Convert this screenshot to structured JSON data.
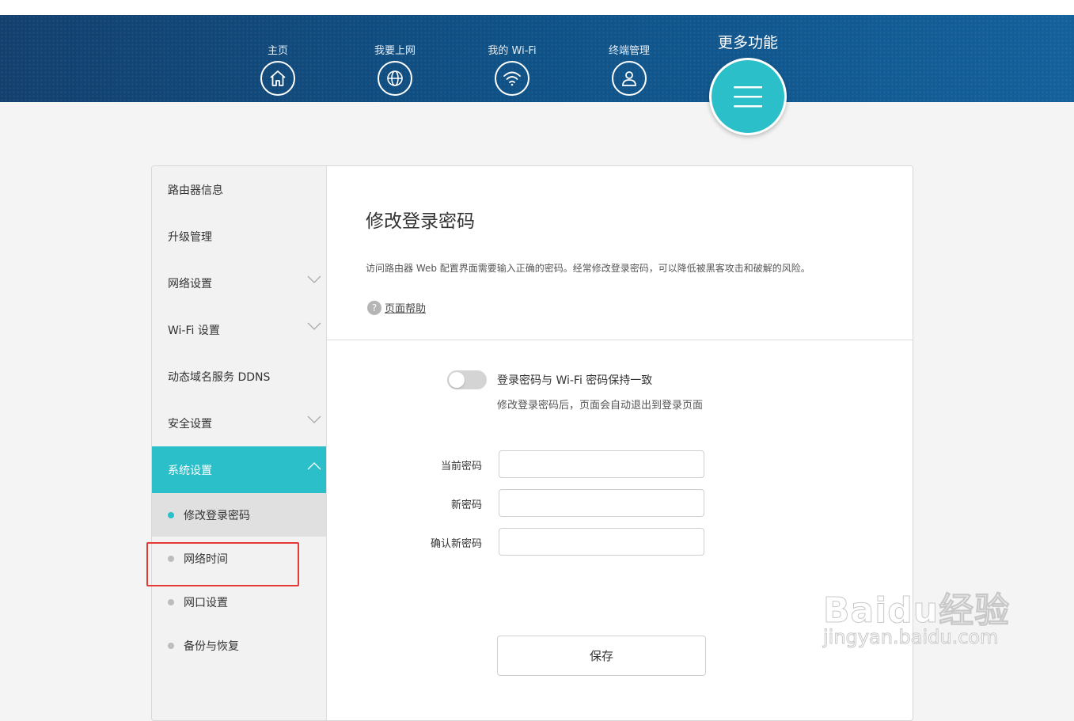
{
  "nav": {
    "home": "主页",
    "internet": "我要上网",
    "wifi": "我的 Wi-Fi",
    "devices": "终端管理",
    "more": "更多功能"
  },
  "sidebar": {
    "items": [
      {
        "label": "路由器信息"
      },
      {
        "label": "升级管理"
      },
      {
        "label": "网络设置"
      },
      {
        "label": "Wi-Fi 设置"
      },
      {
        "label": "动态域名服务 DDNS"
      },
      {
        "label": "安全设置"
      },
      {
        "label": "系统设置"
      }
    ],
    "sub_items": [
      {
        "label": "修改登录密码"
      },
      {
        "label": "网络时间"
      },
      {
        "label": "网口设置"
      },
      {
        "label": "备份与恢复"
      }
    ]
  },
  "main": {
    "title": "修改登录密码",
    "description": "访问路由器 Web 配置界面需要输入正确的密码。经常修改登录密码，可以降低被黑客攻击和破解的风险。",
    "help": "页面帮助",
    "toggle_label": "登录密码与 Wi-Fi 密码保持一致",
    "toggle_hint": "修改登录密码后，页面会自动退出到登录页面",
    "fields": {
      "current": "当前密码",
      "new": "新密码",
      "confirm": "确认新密码"
    },
    "save": "保存"
  },
  "watermark": {
    "logo": "Baidu经验",
    "url": "jingyan.baidu.com"
  },
  "colors": {
    "header": "#0f5287",
    "accent": "#2abfc9",
    "highlight": "#e53935"
  }
}
